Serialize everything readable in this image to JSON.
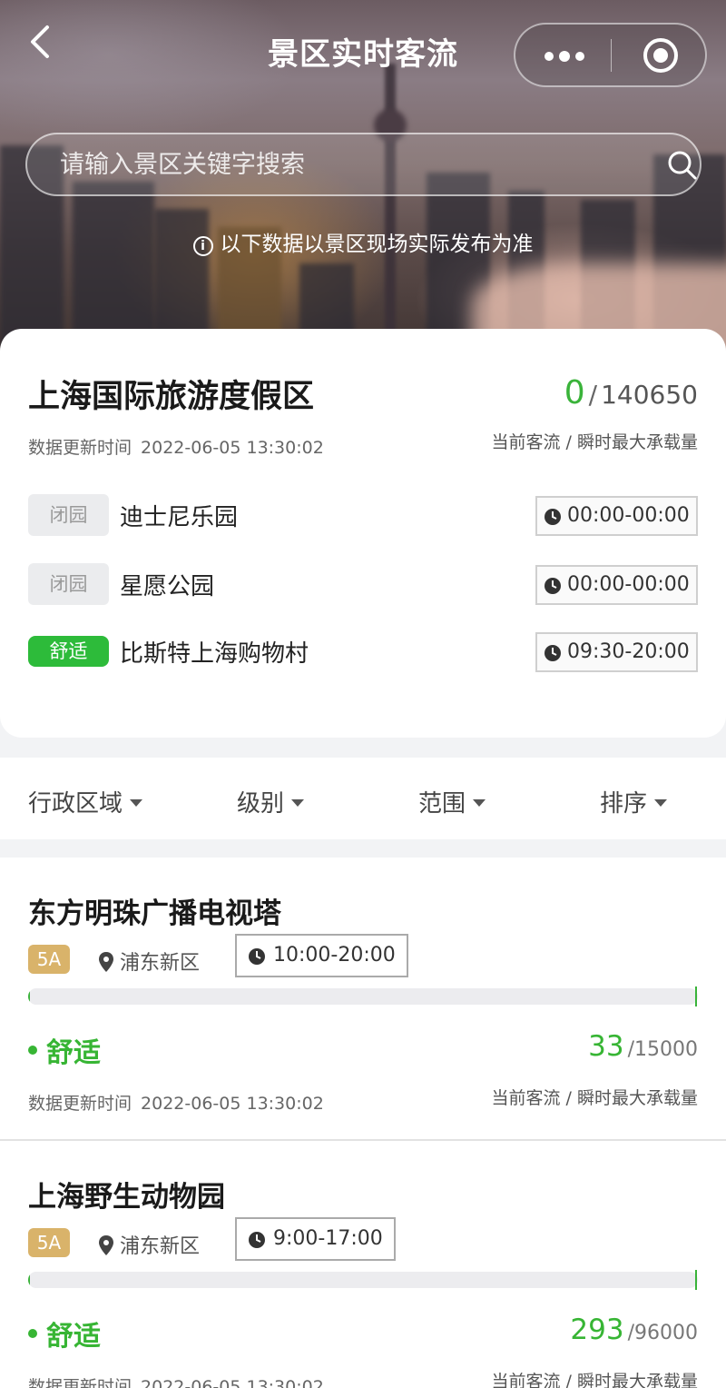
{
  "header": {
    "title": "景区实时客流",
    "back_icon": "chevron-left-icon",
    "more_icon": "more-dots-icon",
    "target_icon": "target-circle-icon"
  },
  "search": {
    "placeholder": "请输入景区关键字搜索",
    "icon": "search-icon"
  },
  "notice": {
    "text": "以下数据以景区现场实际发布为准",
    "icon": "info-icon"
  },
  "resort": {
    "name": "上海国际旅游度假区",
    "current": "0",
    "capacity": "140650",
    "update_label": "数据更新时间",
    "update_time": "2022-06-05 13:30:02",
    "legend": "当前客流 / 瞬时最大承载量",
    "parks": [
      {
        "status": "闭园",
        "name": "迪士尼乐园",
        "hours": "00:00-00:00"
      },
      {
        "status": "闭园",
        "name": "星愿公园",
        "hours": "00:00-00:00"
      },
      {
        "status": "舒适",
        "name": "比斯特上海购物村",
        "hours": "09:30-20:00"
      }
    ]
  },
  "filters": [
    "行政区域",
    "级别",
    "范围",
    "排序"
  ],
  "attractions": [
    {
      "name": "东方明珠广播电视塔",
      "grade": "5A",
      "district": "浦东新区",
      "hours": "10:00-20:00",
      "level": "舒适",
      "current": "33",
      "capacity": "/15000",
      "load_fraction": 0.0022,
      "update_label": "数据更新时间",
      "update_time": "2022-06-05 13:30:02",
      "legend": "当前客流 / 瞬时最大承载量"
    },
    {
      "name": "上海野生动物园",
      "grade": "5A",
      "district": "浦东新区",
      "hours": "9:00-17:00",
      "level": "舒适",
      "current": "293",
      "capacity": "/96000",
      "load_fraction": 0.0031,
      "update_label": "数据更新时间",
      "update_time": "2022-06-05 13:30:02",
      "legend": "当前客流 / 瞬时最大承载量"
    }
  ],
  "colors": {
    "accent_green": "#37b534",
    "closed_tag_bg": "#ebecee",
    "grade_badge": "#d9b36a"
  }
}
